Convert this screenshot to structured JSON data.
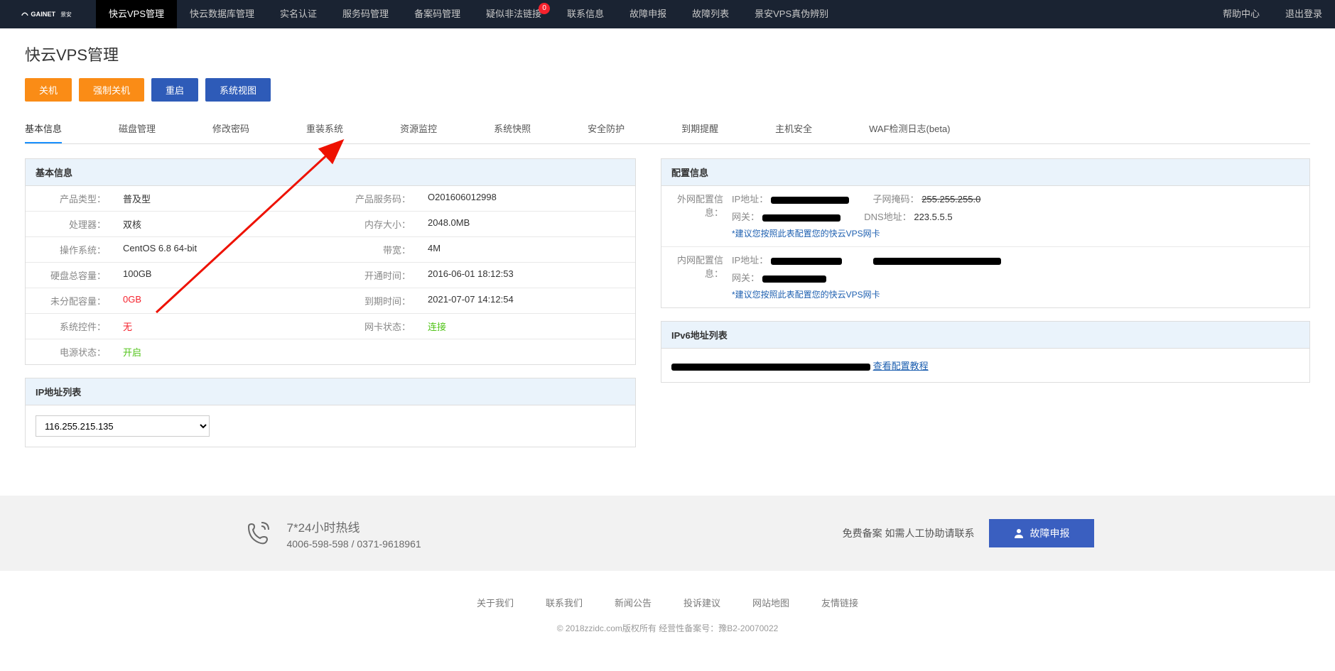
{
  "nav": {
    "items": [
      {
        "label": "快云VPS管理",
        "active": true
      },
      {
        "label": "快云数据库管理"
      },
      {
        "label": "实名认证"
      },
      {
        "label": "服务码管理"
      },
      {
        "label": "备案码管理"
      },
      {
        "label": "疑似非法链接",
        "badge": "0"
      },
      {
        "label": "联系信息"
      },
      {
        "label": "故障申报"
      },
      {
        "label": "故障列表"
      },
      {
        "label": "景安VPS真伪辨别"
      }
    ],
    "right": [
      {
        "label": "帮助中心"
      },
      {
        "label": "退出登录"
      }
    ]
  },
  "page": {
    "title": "快云VPS管理"
  },
  "actions": [
    {
      "label": "关机",
      "cls": "btn-orange"
    },
    {
      "label": "强制关机",
      "cls": "btn-orange"
    },
    {
      "label": "重启",
      "cls": "btn-blue"
    },
    {
      "label": "系统视图",
      "cls": "btn-blue"
    }
  ],
  "tabs": [
    {
      "label": "基本信息",
      "active": true
    },
    {
      "label": "磁盘管理"
    },
    {
      "label": "修改密码"
    },
    {
      "label": "重装系统"
    },
    {
      "label": "资源监控"
    },
    {
      "label": "系统快照"
    },
    {
      "label": "安全防护"
    },
    {
      "label": "到期提醒"
    },
    {
      "label": "主机安全"
    },
    {
      "label": "WAF检测日志(beta)"
    }
  ],
  "basic": {
    "title": "基本信息",
    "product_type_l": "产品类型：",
    "product_type": "普及型",
    "service_code_l": "产品服务码：",
    "service_code": "O201606012998",
    "cpu_l": "处理器：",
    "cpu": "双核",
    "mem_l": "内存大小：",
    "mem": "2048.0MB",
    "os_l": "操作系统：",
    "os": "CentOS 6.8 64-bit",
    "bw_l": "带宽：",
    "bw": "4M",
    "disk_l": "硬盘总容量：",
    "disk": "100GB",
    "open_l": "开通时间：",
    "open": "2016-06-01 18:12:53",
    "unalloc_l": "未分配容量：",
    "unalloc": "0GB",
    "expire_l": "到期时间：",
    "expire": "2021-07-07 14:12:54",
    "ctrl_l": "系统控件：",
    "ctrl": "无",
    "nic_l": "网卡状态：",
    "nic": "连接",
    "power_l": "电源状态：",
    "power": "开启"
  },
  "config": {
    "title": "配置信息",
    "ext_l": "外网配置信息：",
    "ip_k": "IP地址：",
    "mask_k": "子网掩码：",
    "gw_k": "网关：",
    "dns_k": "DNS地址：",
    "ext_mask": "255.255.255.0",
    "ext_dns": "223.5.5.5",
    "suggest": "*建议您按照此表配置您的快云VPS网卡",
    "int_l": "内网配置信息："
  },
  "iplist": {
    "title": "IP地址列表",
    "selected": "116.255.215.135"
  },
  "ipv6": {
    "title": "IPv6地址列表",
    "link": "查看配置教程"
  },
  "footer": {
    "hotline_t": "7*24小时热线",
    "hotline_n": "4006-598-598 / 0371-9618961",
    "record": "免费备案 如需人工协助请联系",
    "report": "故障申报",
    "links": [
      "关于我们",
      "联系我们",
      "新闻公告",
      "投诉建议",
      "网站地图",
      "友情链接"
    ],
    "copyright": "© 2018zzidc.com版权所有 经营性备案号：豫B2-20070022"
  }
}
